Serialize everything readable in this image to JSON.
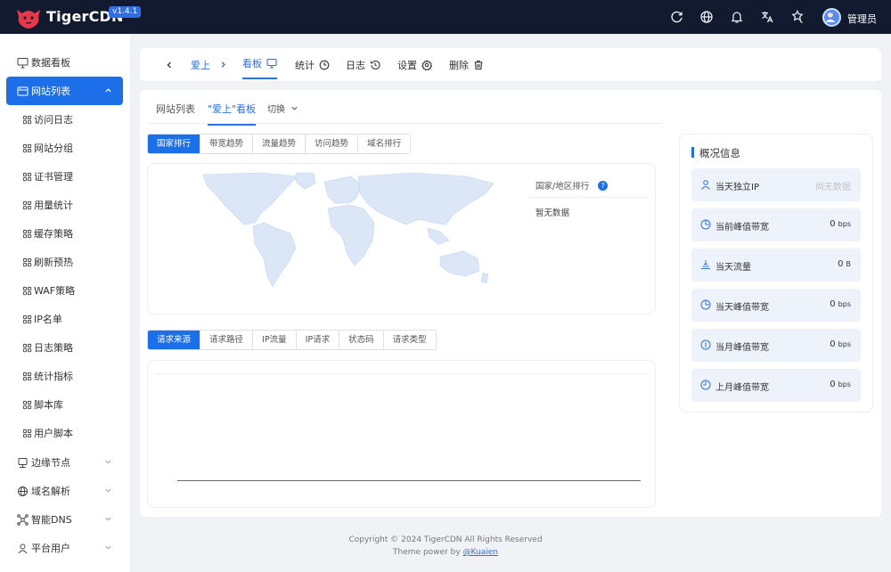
{
  "app": {
    "brand": "TigerCDN",
    "version": "v1.4.1",
    "user": "管理员"
  },
  "topbar_icons": [
    "refresh-icon",
    "globe-icon",
    "bell-icon",
    "translate-icon",
    "theme-icon"
  ],
  "sidebar": {
    "items": [
      {
        "label": "数据看板",
        "icon": "monitor-icon"
      },
      {
        "label": "网站列表",
        "icon": "site-icon",
        "active": true
      },
      {
        "label": "访问日志",
        "icon": "grid-icon"
      },
      {
        "label": "网站分组",
        "icon": "grid-icon"
      },
      {
        "label": "证书管理",
        "icon": "grid-icon"
      },
      {
        "label": "用量统计",
        "icon": "grid-icon"
      },
      {
        "label": "缓存策略",
        "icon": "grid-icon"
      },
      {
        "label": "刷新预热",
        "icon": "grid-icon"
      },
      {
        "label": "WAF策略",
        "icon": "grid-icon"
      },
      {
        "label": "IP名单",
        "icon": "grid-icon"
      },
      {
        "label": "日志策略",
        "icon": "grid-icon"
      },
      {
        "label": "统计指标",
        "icon": "grid-icon"
      },
      {
        "label": "脚本库",
        "icon": "grid-icon"
      },
      {
        "label": "用户脚本",
        "icon": "grid-icon"
      },
      {
        "label": "边缘节点",
        "icon": "node-icon"
      },
      {
        "label": "域名解析",
        "icon": "globe-icon"
      },
      {
        "label": "智能DNS",
        "icon": "dns-icon"
      },
      {
        "label": "平台用户",
        "icon": "user-icon"
      }
    ]
  },
  "crumbs": {
    "site": "爱上",
    "dashboard": "看板",
    "stats": "统计",
    "logs": "日志",
    "settings": "设置",
    "delete": "删除"
  },
  "tabs": {
    "list": "网站列表",
    "current": "\"爱上\"看板",
    "switch": "切换"
  },
  "map_tabs": [
    "国家排行",
    "带宽趋势",
    "流量趋势",
    "访问趋势",
    "域名排行"
  ],
  "map_panel": {
    "header": "国家/地区排行",
    "empty": "暂无数据"
  },
  "req_tabs": [
    "请求来源",
    "请求路径",
    "IP流量",
    "IP请求",
    "状态码",
    "请求类型"
  ],
  "overview": {
    "title": "概况信息",
    "stats": [
      {
        "label": "当天独立IP",
        "value": "尚无数据",
        "unit": "",
        "muted": true
      },
      {
        "label": "当前峰值带宽",
        "value": "0",
        "unit": "bps"
      },
      {
        "label": "当天流量",
        "value": "0",
        "unit": "B"
      },
      {
        "label": "当天峰值带宽",
        "value": "0",
        "unit": "bps"
      },
      {
        "label": "当月峰值带宽",
        "value": "0",
        "unit": "bps"
      },
      {
        "label": "上月峰值带宽",
        "value": "0",
        "unit": "bps"
      }
    ]
  },
  "footer": {
    "copyright": "Copyright © 2024 TigerCDN All Rights Reserved",
    "theme_prefix": "Theme power by ",
    "theme_link": "@Kuaien"
  },
  "colors": {
    "primary": "#1c6fe8",
    "topbar": "#111a2e",
    "brand_red": "#e8364a"
  }
}
